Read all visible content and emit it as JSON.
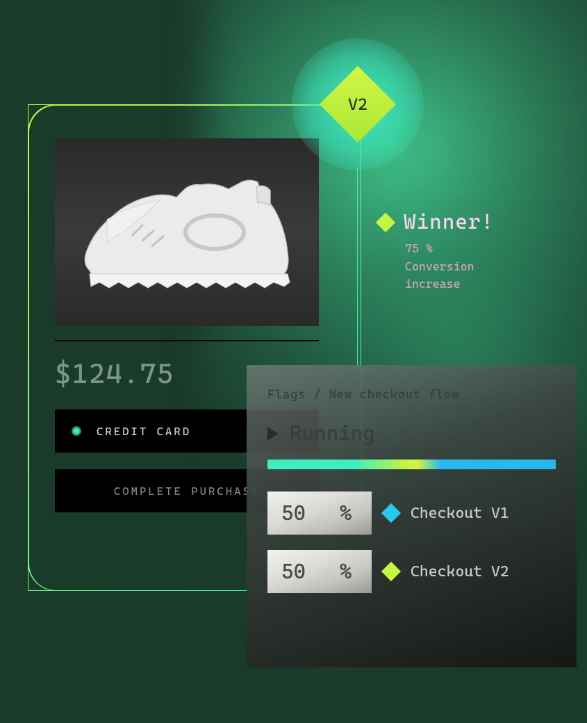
{
  "badge": {
    "label": "V2"
  },
  "product": {
    "price": "$124.75",
    "payment_label": "CREDIT CARD",
    "cta_label": "COMPLETE PURCHASE"
  },
  "winner": {
    "title": "Winner!",
    "line1": "75 %",
    "line2": "Conversion",
    "line3": "increase"
  },
  "flags": {
    "breadcrumb_section": "Flags",
    "breadcrumb_sep": " / ",
    "breadcrumb_name": "New checkout flow",
    "status": "Running",
    "percent_symbol": "%",
    "variants": [
      {
        "percent": "50",
        "label": "Checkout V1",
        "color": "#28c8f0"
      },
      {
        "percent": "50",
        "label": "Checkout V2",
        "color": "#c4f542"
      }
    ]
  }
}
